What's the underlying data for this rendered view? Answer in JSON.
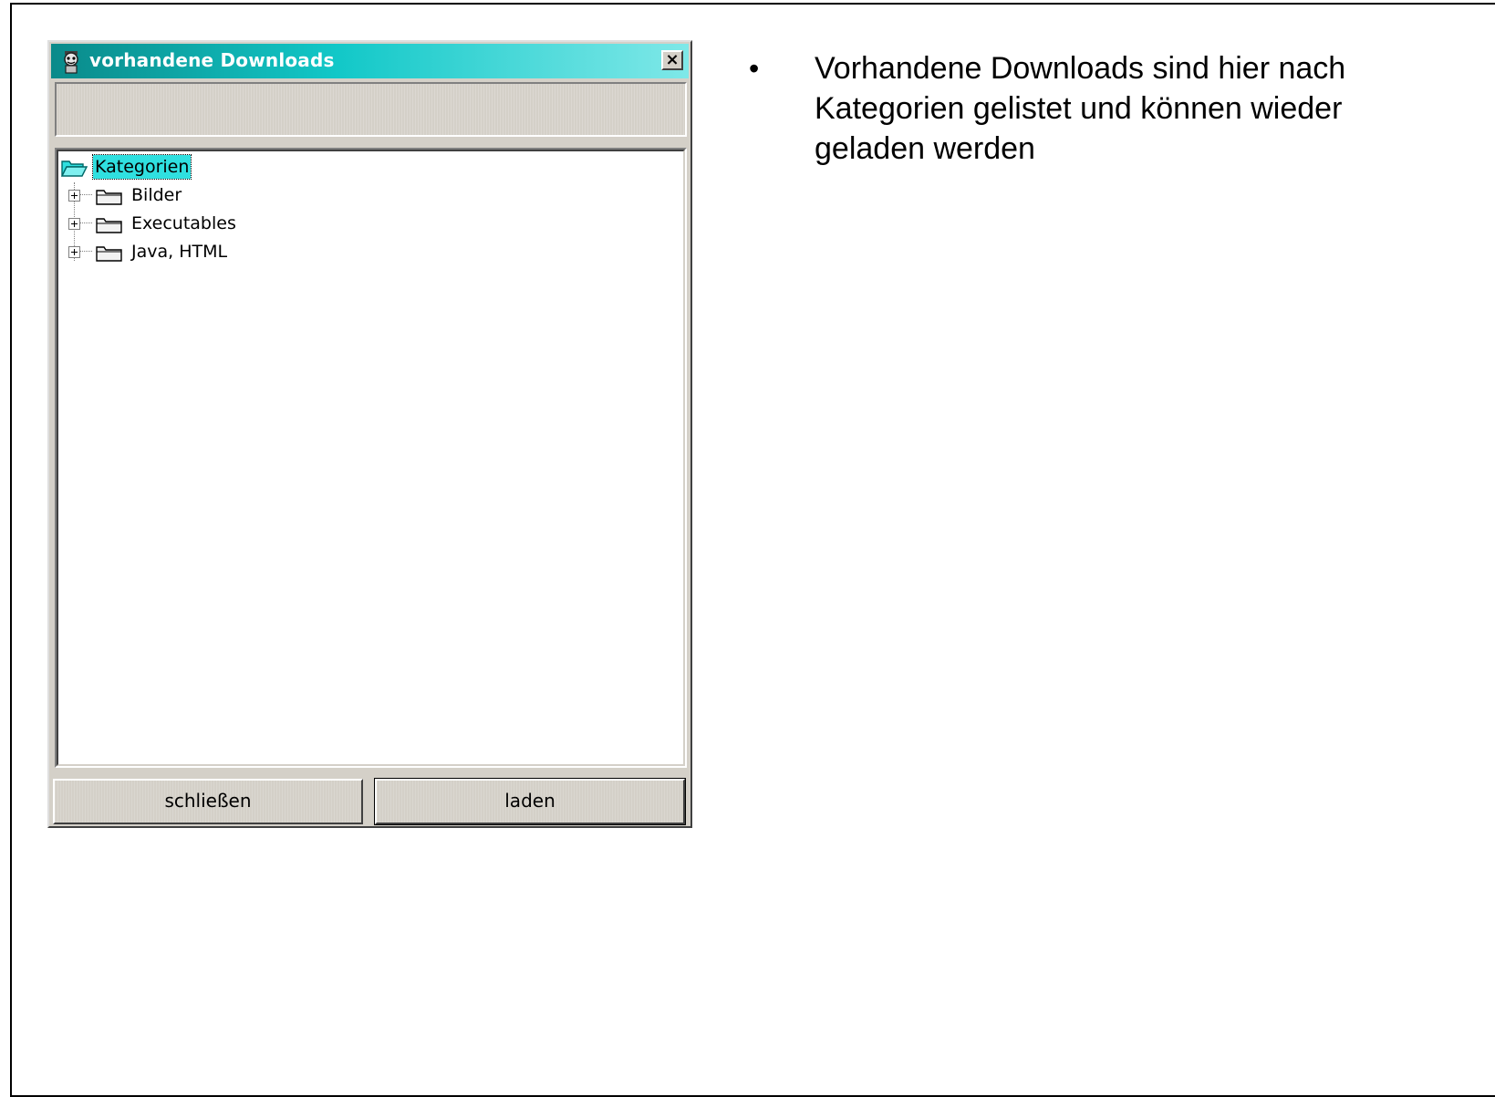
{
  "window": {
    "title": "vorhandene Downloads",
    "close_glyph": "×",
    "title_icon": "app-icon"
  },
  "tree": {
    "root": {
      "label": "Kategorien",
      "icon": "open-folder-icon"
    },
    "items": [
      {
        "label": "Bilder",
        "icon": "folder-icon",
        "expander": "+"
      },
      {
        "label": "Executables",
        "icon": "folder-icon",
        "expander": "+"
      },
      {
        "label": "Java, HTML",
        "icon": "folder-icon",
        "expander": "+"
      }
    ]
  },
  "buttons": {
    "close_label": "schließen",
    "load_label": "laden"
  },
  "bullet": {
    "marker": "•",
    "text": "Vorhandene Downloads sind hier nach Kategorien gelistet und können wieder geladen werden"
  },
  "colors": {
    "titlebar_start": "#0a8a8a",
    "titlebar_end": "#7fe8e8",
    "selection": "#2fe0e0",
    "window_face": "#d4d0c8"
  }
}
